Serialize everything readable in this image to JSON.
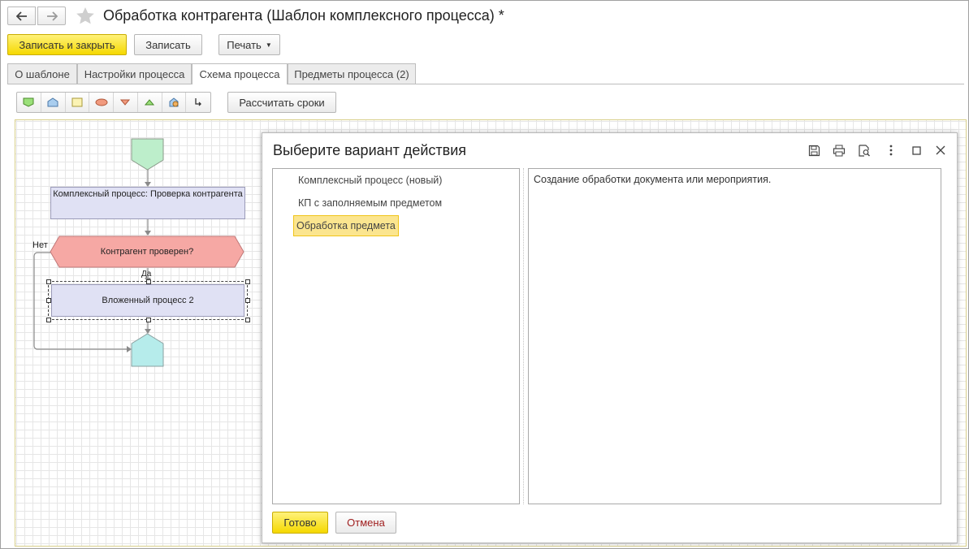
{
  "window": {
    "title": "Обработка контрагента (Шаблон комплексного процесса) *",
    "back_icon": "arrow-left-icon",
    "forward_icon": "arrow-right-icon",
    "favorite_icon": "star-icon"
  },
  "toolbar": {
    "save_close_label": "Записать и закрыть",
    "save_label": "Записать",
    "print_label": "Печать"
  },
  "tabs": [
    {
      "label": "О шаблоне"
    },
    {
      "label": "Настройки процесса"
    },
    {
      "label": "Схема процесса",
      "active": true
    },
    {
      "label": "Предметы процесса (2)"
    }
  ],
  "schema_toolbar": {
    "tools": [
      "start-point-icon",
      "end-point-icon",
      "action-icon",
      "condition-icon",
      "split-icon",
      "merge-icon",
      "subprocess-icon",
      "connector-icon"
    ],
    "calc_label": "Рассчитать сроки"
  },
  "diagram": {
    "process_node": "Комплексный процесс: Проверка контрагента",
    "condition_node": "Контрагент проверен?",
    "no_label": "Нет",
    "yes_label": "Да",
    "nested_node": "Вложенный процесс 2"
  },
  "dialog": {
    "title": "Выберите вариант действия",
    "items": [
      {
        "label": "Комплексный процесс (новый)"
      },
      {
        "label": "КП с заполняемым предметом"
      },
      {
        "label": "Обработка предмета",
        "selected": true
      }
    ],
    "description": "Создание обработки документа или мероприятия.",
    "ok_label": "Готово",
    "cancel_label": "Отмена"
  },
  "colors": {
    "primary_button": "#f5d800",
    "selection": "#fbe58f",
    "cancel_text": "#a02020"
  }
}
